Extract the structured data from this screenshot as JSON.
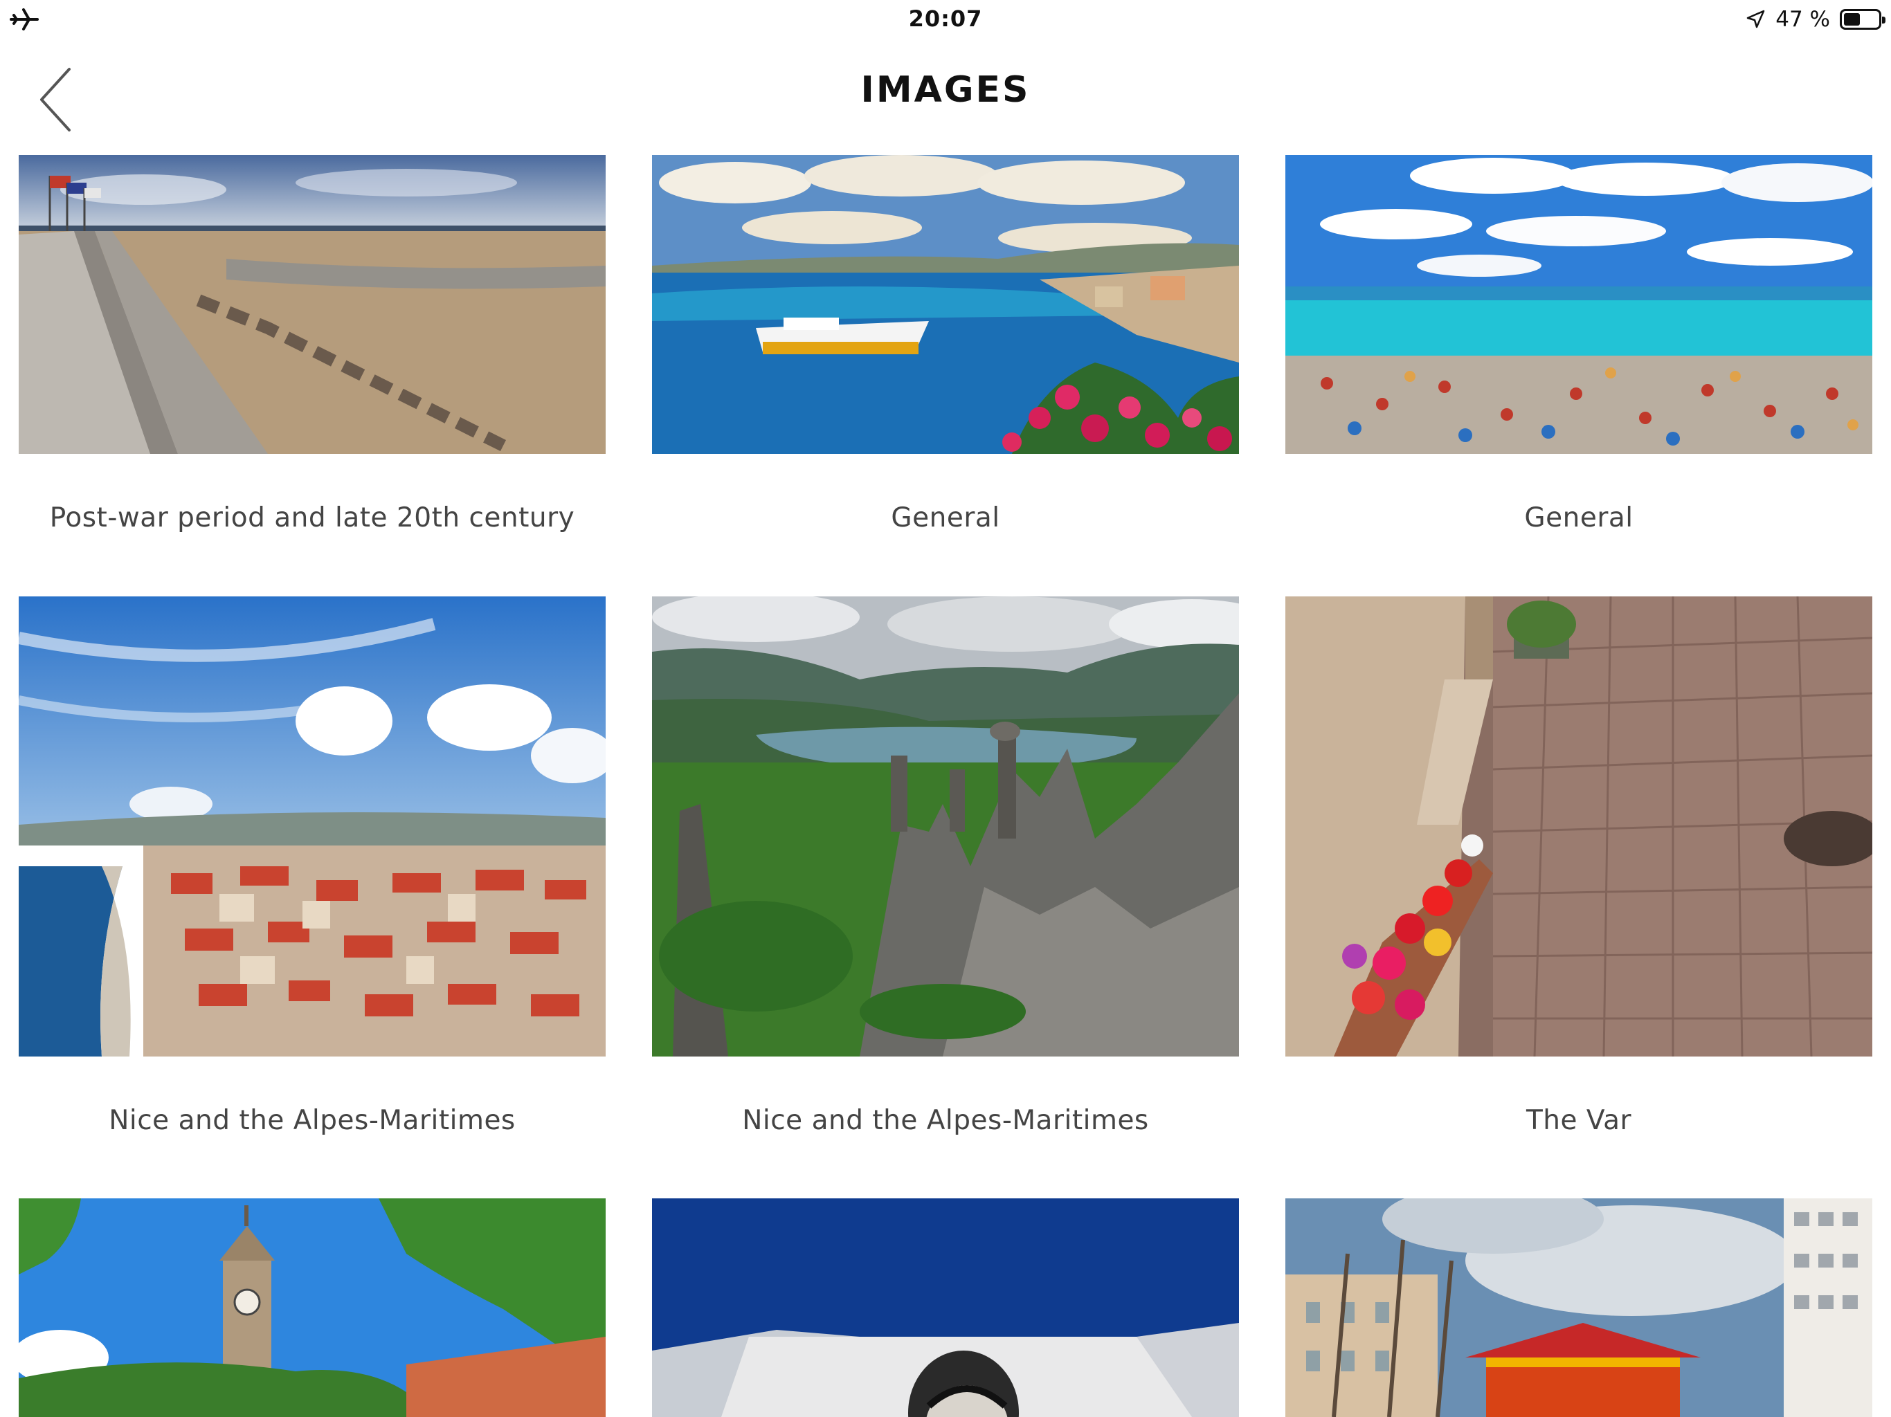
{
  "status_bar": {
    "time": "20:07",
    "battery_text": "47 %",
    "battery_level": 0.47,
    "icons": [
      "airplane-mode-icon",
      "location-arrow-icon",
      "battery-icon"
    ]
  },
  "nav": {
    "title": "IMAGES",
    "back_icon": "chevron-left-icon"
  },
  "gallery": [
    {
      "caption": "Post-war period and late 20th century",
      "scene": "beach promenade with flags"
    },
    {
      "caption": "General",
      "scene": "coastal bay with ferry and flowers"
    },
    {
      "caption": "General",
      "scene": "crowded beach with turquoise sea"
    },
    {
      "caption": "Nice and the Alpes-Maritimes",
      "scene": "aerial city and coastline"
    },
    {
      "caption": "Nice and the Alpes-Maritimes",
      "scene": "rock pillars above lake"
    },
    {
      "caption": "The Var",
      "scene": "cobblestone lane with flower box"
    },
    {
      "caption": "",
      "scene": "clock tower among trees"
    },
    {
      "caption": "",
      "scene": "poster on building facade"
    },
    {
      "caption": "",
      "scene": "red pagoda and buildings"
    }
  ],
  "colors": {
    "background": "#ffffff",
    "title_text": "#111111",
    "caption_text": "#444444"
  }
}
